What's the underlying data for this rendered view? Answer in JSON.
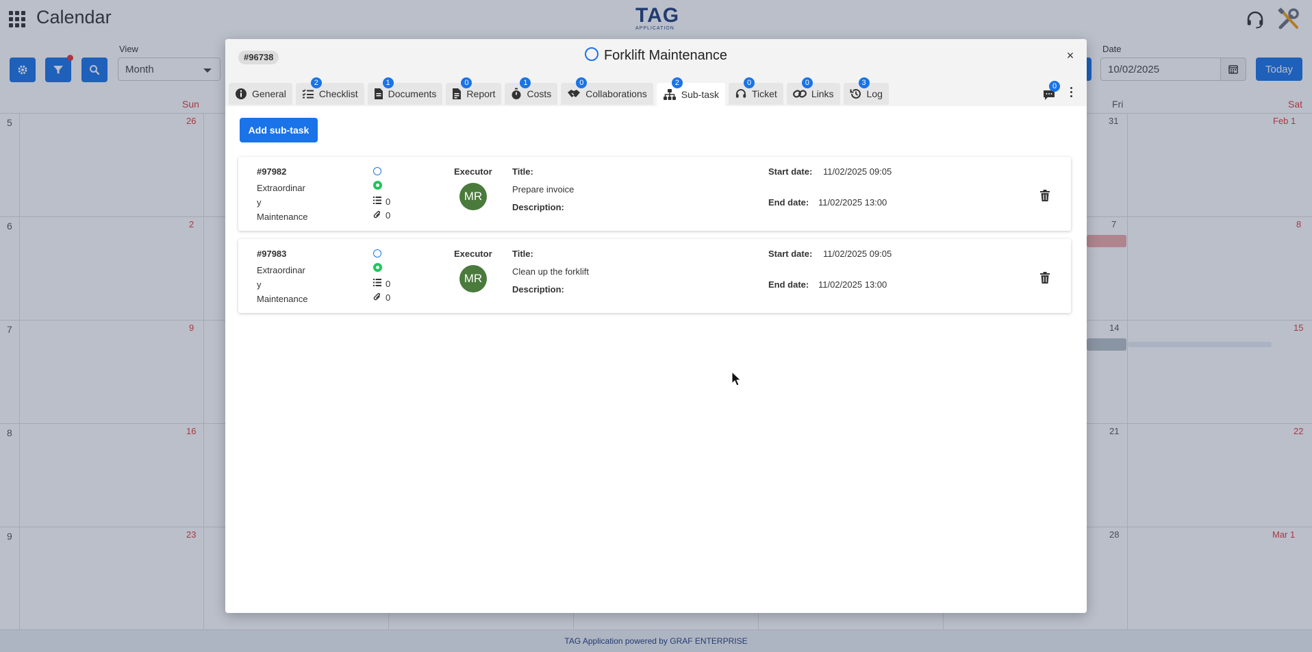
{
  "app": {
    "title": "Calendar",
    "logo_text": "TAG",
    "logo_sub": "APPLICATION"
  },
  "toolbar": {
    "view_label": "View",
    "view_value": "Month",
    "date_label": "Date",
    "date_value": "10/02/2025",
    "today_label": "Today"
  },
  "calendar": {
    "days_of_week": {
      "sun": "Sun",
      "fri": "Fri",
      "sat": "Sat"
    },
    "weeks": [
      "5",
      "6",
      "7",
      "8",
      "9"
    ],
    "sun_dates": [
      "26",
      "2",
      "9",
      "16",
      "23"
    ],
    "fri_dates": [
      "31",
      "7",
      "14",
      "21",
      "28"
    ],
    "sat_dates": [
      "Feb 1",
      "8",
      "15",
      "22",
      "Mar 1"
    ]
  },
  "footer": {
    "text": "TAG Application powered by GRAF ENTERPRISE"
  },
  "modal": {
    "id": "#96738",
    "title": "Forklift Maintenance",
    "close": "×",
    "chat_count": "0",
    "tabs": [
      {
        "label": "General",
        "icon": "info-icon",
        "badge": ""
      },
      {
        "label": "Checklist",
        "icon": "checklist-icon",
        "badge": "2"
      },
      {
        "label": "Documents",
        "icon": "document-icon",
        "badge": "1"
      },
      {
        "label": "Report",
        "icon": "report-icon",
        "badge": "0"
      },
      {
        "label": "Costs",
        "icon": "stopwatch-icon",
        "badge": "1"
      },
      {
        "label": "Collaborations",
        "icon": "handshake-icon",
        "badge": "0"
      },
      {
        "label": "Sub-task",
        "icon": "sitemap-icon",
        "badge": "2"
      },
      {
        "label": "Ticket",
        "icon": "headset-icon",
        "badge": "0"
      },
      {
        "label": "Links",
        "icon": "link-icon",
        "badge": "0"
      },
      {
        "label": "Log",
        "icon": "history-icon",
        "badge": "3"
      }
    ],
    "add_button": "Add sub-task",
    "labels": {
      "executor": "Executor",
      "title": "Title:",
      "description": "Description:",
      "start_date": "Start date:",
      "end_date": "End date:"
    },
    "subtasks": [
      {
        "id": "#97982",
        "type_line1": "Extraordinar",
        "type_line2": "y",
        "type_line3": "Maintenance",
        "checklist_count": "0",
        "attachment_count": "0",
        "executor_initials": "MR",
        "title": "Prepare invoice",
        "start_date": "11/02/2025 09:05",
        "end_date": "11/02/2025 13:00"
      },
      {
        "id": "#97983",
        "type_line1": "Extraordinar",
        "type_line2": "y",
        "type_line3": "Maintenance",
        "checklist_count": "0",
        "attachment_count": "0",
        "executor_initials": "MR",
        "title": "Clean up the forklift",
        "start_date": "11/02/2025 09:05",
        "end_date": "11/02/2025 13:00"
      }
    ]
  },
  "colors": {
    "accent": "#1a73e8",
    "status_green": "#22c55e",
    "avatar": "#4a7a3c",
    "weekend_red": "#e53935"
  }
}
